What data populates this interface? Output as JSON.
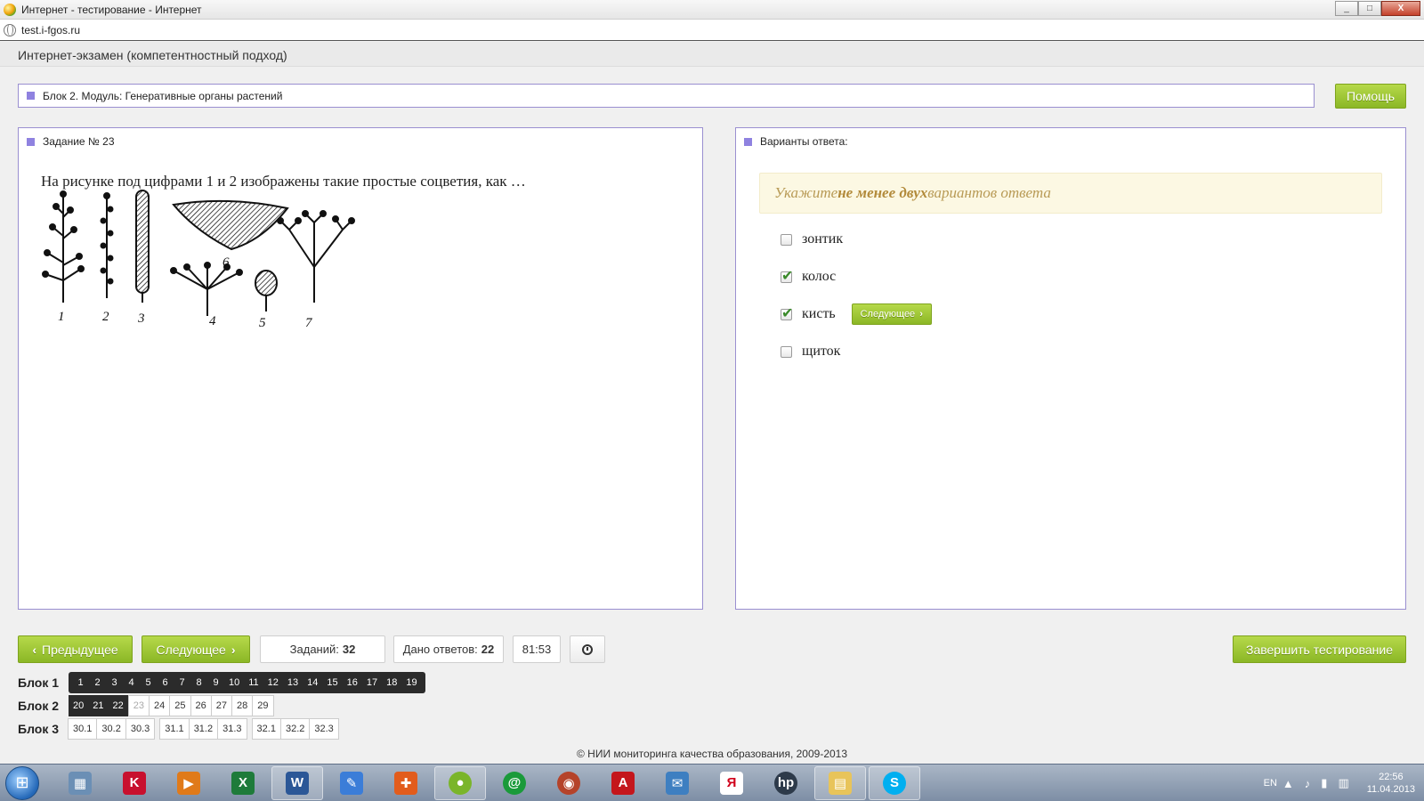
{
  "window": {
    "title": "Интернет - тестирование - Интернет",
    "controls": [
      "_",
      "□",
      "X"
    ]
  },
  "address": {
    "url": "test.i-fgos.ru"
  },
  "header": {
    "title": "Интернет-экзамен (компетентностный подход)"
  },
  "block_bar": {
    "label": "Блок 2. Модуль: Генеративные органы растений",
    "help_label": "Помощь"
  },
  "task": {
    "title": "Задание № 23",
    "question": "На рисунке под цифрами 1 и 2 изображены такие простые соцветия, как …",
    "figure_labels": [
      "1",
      "2",
      "3",
      "4",
      "5",
      "6",
      "7"
    ]
  },
  "answers_panel": {
    "title": "Варианты ответа:",
    "hint_before": "Укажите ",
    "hint_bold": "не менее двух",
    "hint_after": " вариантов ответа",
    "options": [
      {
        "label": "зонтик",
        "checked": false
      },
      {
        "label": "колос",
        "checked": true
      },
      {
        "label": "кисть",
        "checked": true
      },
      {
        "label": "щиток",
        "checked": false
      }
    ],
    "inline_next_label": "Следующее"
  },
  "controls": {
    "prev_label": "Предыдущее",
    "next_label": "Следующее",
    "tasks_label": "Заданий:",
    "tasks_count": "32",
    "answered_label": "Дано ответов:",
    "answered_count": "22",
    "timer": "81:53",
    "finish_label": "Завершить тестирование"
  },
  "blocks": [
    {
      "label": "Блок 1",
      "groups": [
        [
          "1",
          "2",
          "3",
          "4",
          "5",
          "6",
          "7",
          "8",
          "9",
          "10",
          "11",
          "12",
          "13",
          "14",
          "15",
          "16",
          "17",
          "18",
          "19"
        ]
      ],
      "state": "dark"
    },
    {
      "label": "Блок 2",
      "dark": [
        "20",
        "21",
        "22"
      ],
      "current": "23",
      "rest": [
        "24",
        "25",
        "26",
        "27",
        "28",
        "29"
      ]
    },
    {
      "label": "Блок 3",
      "groups": [
        [
          "30.1",
          "30.2",
          "30.3"
        ],
        [
          "31.1",
          "31.2",
          "31.3"
        ],
        [
          "32.1",
          "32.2",
          "32.3"
        ]
      ]
    }
  ],
  "footer": {
    "text": "© НИИ мониторинга качества образования, 2009-2013"
  },
  "taskbar": {
    "tray_lang": "EN",
    "time": "22:56",
    "date": "11.04.2013",
    "apps": [
      "calculator-icon",
      "kaspersky-icon",
      "media-player-icon",
      "excel-icon",
      "word-icon",
      "paint-icon",
      "puzzle-icon",
      "browser-icon",
      "mail-agent-icon",
      "network-icon",
      "acrobat-icon",
      "outlook-icon",
      "yandex-icon",
      "hp-icon",
      "explorer-icon",
      "skype-icon"
    ]
  }
}
